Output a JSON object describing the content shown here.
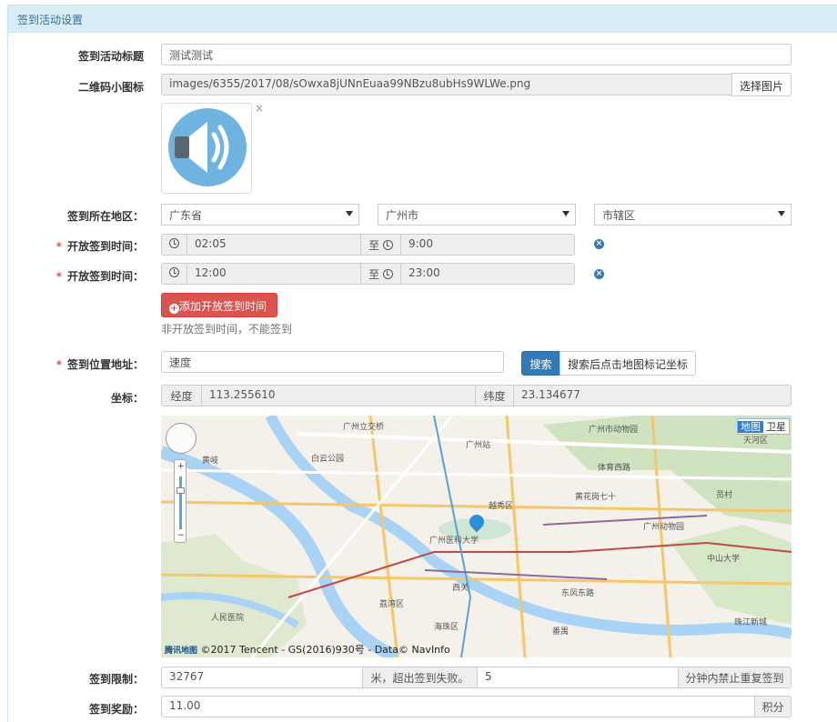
{
  "panel": {
    "title": "签到活动设置"
  },
  "form": {
    "title": {
      "label": "签到活动标题",
      "value": "测试测试"
    },
    "icon": {
      "label": "二维码小图标",
      "path": "images/6355/2017/08/sOwxa8jUNnEuaa99NBzu8ubHs9WLWe.png",
      "choose_button": "选择图片",
      "remove": "×",
      "preview_icon": "speaker-icon"
    },
    "region": {
      "label": "签到所在地区：",
      "province": "广东省",
      "city": "广州市",
      "district": "市辖区"
    },
    "open_times": [
      {
        "label": "开放签到时间：",
        "start": "02:05",
        "to": "至",
        "end": "9:00"
      },
      {
        "label": "开放签到时间：",
        "start": "12:00",
        "to": "至",
        "end": "23:00"
      }
    ],
    "required_mark": "*",
    "add_time_button": "添加开放签到时间",
    "time_hint": "非开放签到时间，不能签到",
    "address": {
      "label": "签到位置地址：",
      "value": "速度",
      "search_button": "搜索",
      "hint_button": "搜索后点击地图标记坐标"
    },
    "coords": {
      "label": "坐标：",
      "lng_label": "经度",
      "lng": "113.255610",
      "lat_label": "纬度",
      "lat": "23.134677"
    },
    "map": {
      "type_map": "地图",
      "type_satellite": "卫星",
      "copyright": "©2017 Tencent - GS(2016)930号 - Data© NavInfo",
      "logo": "腾讯地图",
      "zoom_in": "+",
      "zoom_out": "−",
      "places": [
        "广州立交桥",
        "广州市动物园",
        "黄岐",
        "广州站",
        "白云公园",
        "黄花岗七十",
        "广州动物园",
        "中山大学",
        "广州医科大学",
        "东风东路",
        "珠江新城",
        "西关",
        "番禺",
        "体育西路",
        "荔湾区",
        "海珠区",
        "越秀区",
        "天河区",
        "员村",
        "人民医院"
      ]
    },
    "limit": {
      "label": "签到限制：",
      "distance": "32767",
      "distance_suffix": "米，超出签到失败。",
      "minutes": "5",
      "minutes_suffix": "分钟内禁止重复签到"
    },
    "reward": {
      "label": "签到奖励：",
      "value": "11.00",
      "suffix": "积分"
    }
  },
  "colors": {
    "heading_bg": "#d9edf7",
    "primary": "#337ab7",
    "danger": "#d9534f"
  }
}
